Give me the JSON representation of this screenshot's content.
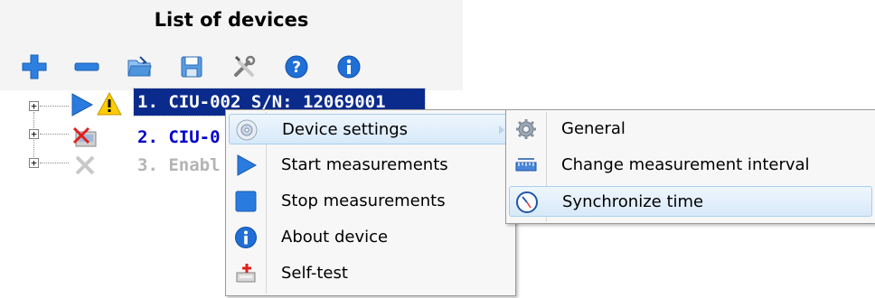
{
  "header": {
    "title": "List of devices"
  },
  "toolbar": {
    "buttons": [
      "add-icon",
      "remove-icon",
      "open-folder-icon",
      "save-icon",
      "tools-icon",
      "help-icon",
      "info-icon"
    ]
  },
  "tree": {
    "items": [
      {
        "label": "1. CIU-002 S/N: 12069001",
        "state": "selected",
        "status": "running-warning"
      },
      {
        "label": "2. CIU-0",
        "state": "normal",
        "status": "disconnected"
      },
      {
        "label": "3. Enabl",
        "state": "disabled",
        "status": "disabled"
      }
    ]
  },
  "context_menu": {
    "items": [
      {
        "label": "Device settings",
        "icon": "settings-disc-icon",
        "has_submenu": true
      },
      {
        "label": "Start measurements",
        "icon": "play-icon"
      },
      {
        "label": "Stop measurements",
        "icon": "stop-icon"
      },
      {
        "label": "About device",
        "icon": "info-icon"
      },
      {
        "label": "Self-test",
        "icon": "self-test-icon"
      }
    ]
  },
  "submenu": {
    "items": [
      {
        "label": "General",
        "icon": "gear-icon"
      },
      {
        "label": "Change measurement interval",
        "icon": "ruler-icon"
      },
      {
        "label": "Synchronize time",
        "icon": "clock-icon"
      }
    ]
  },
  "colors": {
    "selection": "#0a2b8c",
    "accent_blue": "#1f6fd6",
    "link_blue": "#0000c8",
    "disabled_gray": "#b4b4b4"
  }
}
